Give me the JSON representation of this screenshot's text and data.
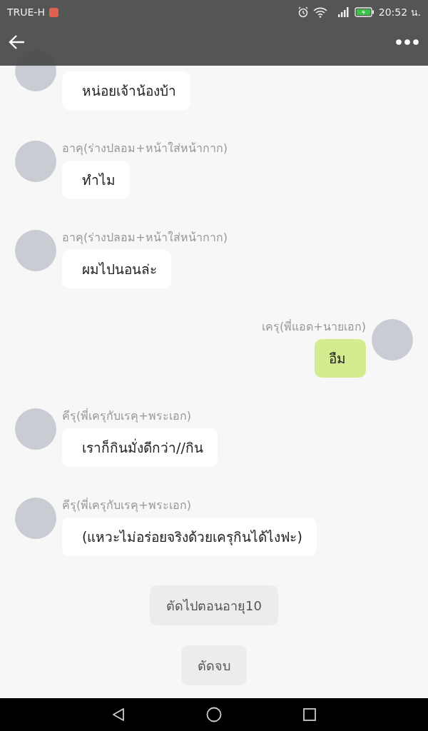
{
  "status_bar": {
    "carrier": "TRUE-H",
    "time": "20:52 น."
  },
  "messages": [
    {
      "kind": "incoming",
      "text": "หน่อยเจ้าน้องบ้า"
    },
    {
      "kind": "incoming",
      "sender": "อาคุ(ร่างปลอม+หน้าใส่หน้ากาก)",
      "text": "ทำไม"
    },
    {
      "kind": "incoming",
      "sender": "อาคุ(ร่างปลอม+หน้าใส่หน้ากาก)",
      "text": "ผมไปนอนล่ะ"
    },
    {
      "kind": "outgoing",
      "sender": "เครุ(พี่แอด+นายเอก)",
      "text": "อืม"
    },
    {
      "kind": "incoming",
      "sender": "คีรุ(พี่เครุกับเรคุ+พระเอก)",
      "text": "เราก็กินมั่งดีกว่า//กิน"
    },
    {
      "kind": "incoming",
      "sender": "คีรุ(พี่เครุกับเรคุ+พระเอก)",
      "text": "(แหวะไม่อร่อยจริงด้วยเครุกินได้ไงฟะ)"
    }
  ],
  "choices": [
    "ตัดไปตอนอายุ10",
    "ตัดจบ"
  ]
}
